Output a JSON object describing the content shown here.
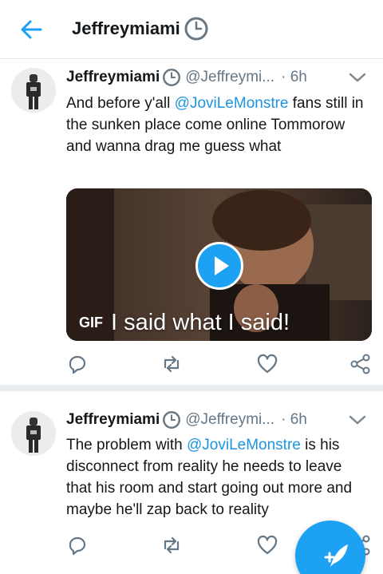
{
  "header": {
    "title": "Jeffreymiami",
    "back_icon": "arrow-left-icon",
    "badge_icon": "clock-icon"
  },
  "tweets": [
    {
      "name": "Jeffreymiami",
      "handle": "@Jeffreymi...",
      "time": "· 6h",
      "text_parts": [
        "And before y'all ",
        "@JoviLeMonstre",
        " fans still in the sunken place come online Tommorow and wanna drag me guess what"
      ],
      "media": {
        "badge": "GIF",
        "caption": "I said what I said!"
      }
    },
    {
      "name": "Jeffreymiami",
      "handle": "@Jeffreymi...",
      "time": "· 6h",
      "text_parts": [
        "The problem with ",
        "@JoviLeMonstre",
        " is his disconnect from reality he needs to leave that his room and start going out more and maybe he'll zap back to reality"
      ]
    }
  ],
  "colors": {
    "accent": "#1da1f2",
    "mention": "#1b95e0",
    "muted": "#657786"
  }
}
